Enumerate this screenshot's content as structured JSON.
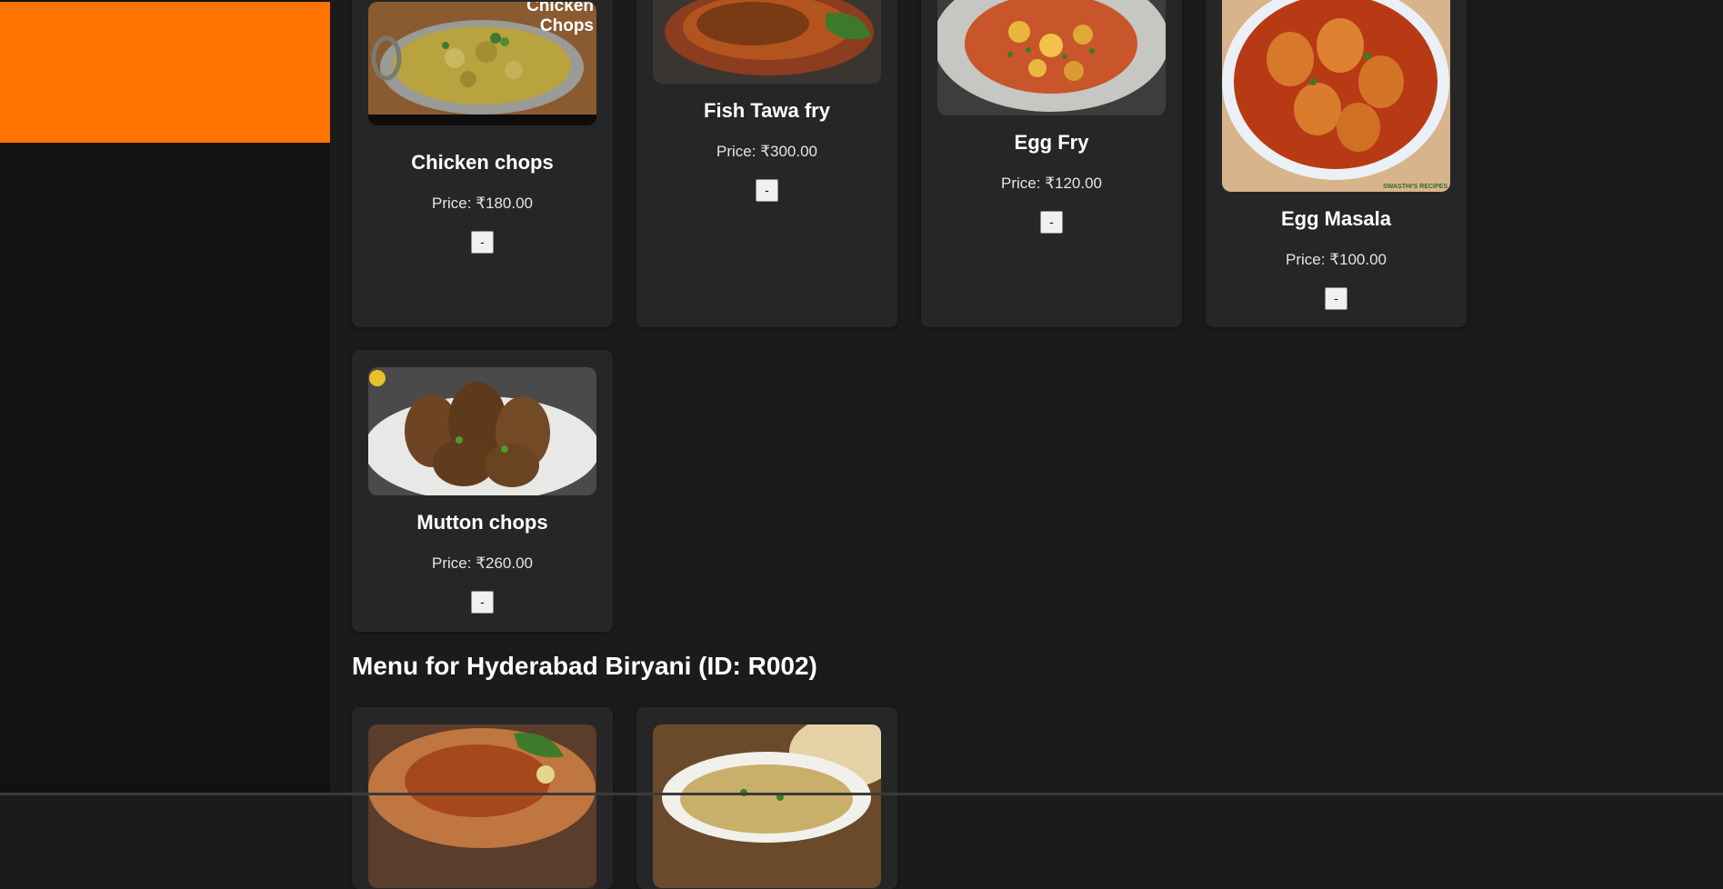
{
  "menu_sections": [
    {
      "items": [
        {
          "name": "Chicken chops",
          "price_label": "Price:",
          "price": "₹180.00",
          "button_label": "-",
          "photo_caption": "Chicken\nChops"
        },
        {
          "name": "Fish Tawa fry",
          "price_label": "Price:",
          "price": "₹300.00",
          "button_label": "-"
        },
        {
          "name": "Egg Fry",
          "price_label": "Price:",
          "price": "₹120.00",
          "button_label": "-"
        },
        {
          "name": "Egg Masala",
          "price_label": "Price:",
          "price": "₹100.00",
          "button_label": "-",
          "photo_watermark": "SWASTHI'S RECIPES"
        },
        {
          "name": "Mutton chops",
          "price_label": "Price:",
          "price": "₹260.00",
          "button_label": "-"
        }
      ]
    },
    {
      "heading": "Menu for Hyderabad Biryani (ID: R002)"
    }
  ],
  "colors": {
    "page_background": "#1b1b1b",
    "sidebar_background": "#121212",
    "sidebar_accent": "#ff7300",
    "card_background": "#262626"
  }
}
